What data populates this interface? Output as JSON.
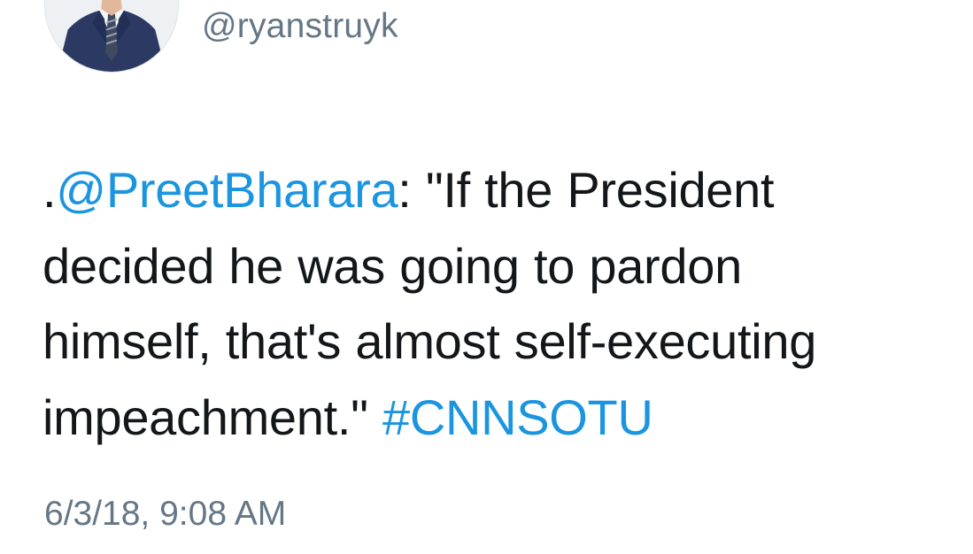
{
  "author": {
    "handle": "@ryanstruyk",
    "avatar_icon": "profile-photo-man-in-suit"
  },
  "tweet": {
    "lines": [
      {
        "segments": [
          {
            "text": ".",
            "kind": "text"
          },
          {
            "text": "@PreetBharara",
            "kind": "mention"
          },
          {
            "text": ": \"If the President",
            "kind": "text"
          }
        ]
      },
      {
        "segments": [
          {
            "text": "decided he was going to pardon",
            "kind": "text"
          }
        ]
      },
      {
        "segments": [
          {
            "text": "himself, that's almost self-executing",
            "kind": "text"
          }
        ]
      },
      {
        "segments": [
          {
            "text": "impeachment.\" ",
            "kind": "text"
          },
          {
            "text": "#CNNSOTU",
            "kind": "hashtag"
          }
        ]
      }
    ],
    "timestamp": "6/3/18, 9:08 AM"
  },
  "colors": {
    "text": "#14171a",
    "link": "#1b95e0",
    "secondary": "#657786",
    "background": "#ffffff"
  }
}
